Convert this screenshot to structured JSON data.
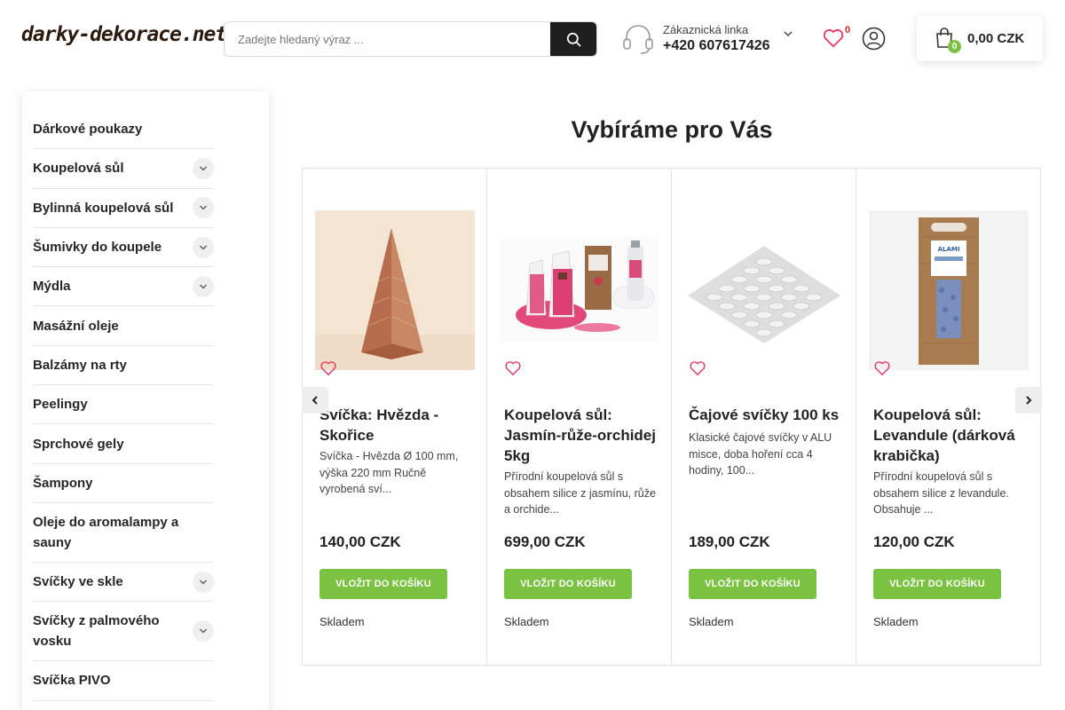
{
  "header": {
    "logo_text": "darky-dekorace.net",
    "search": {
      "placeholder": "Zadejte hledaný výraz ..."
    },
    "support": {
      "label": "Zákaznická linka",
      "phone": "+420 607617426"
    },
    "wishlist_count": "0",
    "cart": {
      "count": "0",
      "total": "0,00 CZK"
    }
  },
  "sidebar": {
    "items": [
      {
        "label": "Dárkové poukazy",
        "expandable": false
      },
      {
        "label": "Koupelová sůl",
        "expandable": true
      },
      {
        "label": "Bylinná koupelová sůl",
        "expandable": true
      },
      {
        "label": "Šumivky do koupele",
        "expandable": true
      },
      {
        "label": "Mýdla",
        "expandable": true
      },
      {
        "label": "Masážní oleje",
        "expandable": false
      },
      {
        "label": "Balzámy na rty",
        "expandable": false
      },
      {
        "label": "Peelingy",
        "expandable": false
      },
      {
        "label": "Sprchové gely",
        "expandable": false
      },
      {
        "label": "Šampony",
        "expandable": false
      },
      {
        "label": "Oleje do aromalampy a sauny",
        "expandable": false
      },
      {
        "label": "Svíčky ve skle",
        "expandable": true
      },
      {
        "label": "Svíčky z palmového vosku",
        "expandable": true
      },
      {
        "label": "Svíčka PIVO",
        "expandable": false
      }
    ]
  },
  "main": {
    "section_title": "Vybíráme pro Vás",
    "products": [
      {
        "name": "Svíčka: Hvězda - Skořice",
        "description": "Svíčka - Hvězda Ø 100 mm, výška 220 mm Ručně vyrobená sví...",
        "price": "140,00 CZK",
        "button": "VLOŽIT DO KOŠÍKU",
        "stock": "Skladem"
      },
      {
        "name": "Koupelová sůl: Jasmín-růže-orchidej 5kg",
        "description": "Přírodní koupelová sůl s obsahem silice z jasmínu, růže a orchide...",
        "price": "699,00 CZK",
        "button": "VLOŽIT DO KOŠÍKU",
        "stock": "Skladem"
      },
      {
        "name": "Čajové svíčky 100 ks",
        "description": "Klasické čajové svíčky v ALU misce, doba hoření cca 4 hodiny, 100...",
        "price": "189,00 CZK",
        "button": "VLOŽIT DO KOŠÍKU",
        "stock": "Skladem"
      },
      {
        "name": "Koupelová sůl: Levandule (dárková krabička)",
        "description": "Přírodní koupelová sůl s obsahem silice z levandule. Obsahuje ...",
        "price": "120,00 CZK",
        "button": "VLOŽIT DO KOŠÍKU",
        "stock": "Skladem"
      }
    ],
    "package_brand": "ALAMI"
  },
  "colors": {
    "accent": "#7cc242",
    "badge_red": "#e02020",
    "heart": "#e8365d",
    "text": "#222222"
  }
}
